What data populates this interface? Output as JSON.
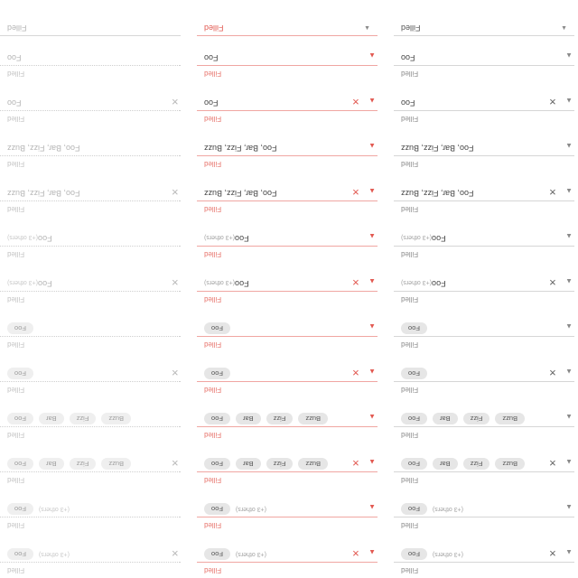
{
  "labels": {
    "filled": "Filled",
    "foo": "Foo",
    "bar": "Bar",
    "fizz": "Fizz",
    "buzz": "Buzz",
    "more": "(+3 others)",
    "foo_list": "Foo, Bar, Fizz, Buzz"
  },
  "icons": {
    "clear": "clear-icon",
    "dropdown": "caret-icon"
  }
}
